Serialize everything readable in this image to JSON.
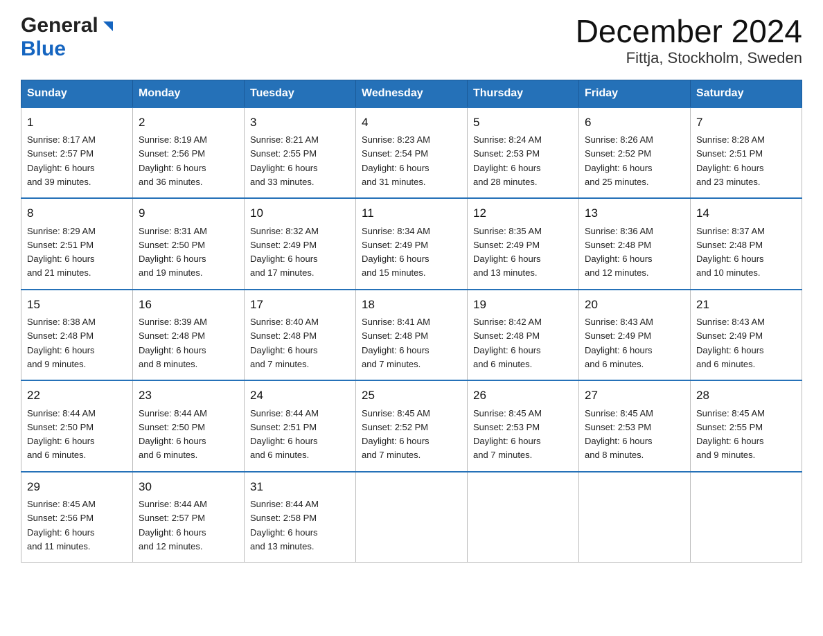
{
  "header": {
    "logo_general": "General",
    "logo_blue": "Blue",
    "month_title": "December 2024",
    "location": "Fittja, Stockholm, Sweden"
  },
  "days_of_week": [
    "Sunday",
    "Monday",
    "Tuesday",
    "Wednesday",
    "Thursday",
    "Friday",
    "Saturday"
  ],
  "weeks": [
    [
      {
        "day": "1",
        "sunrise": "8:17 AM",
        "sunset": "2:57 PM",
        "daylight": "6 hours and 39 minutes."
      },
      {
        "day": "2",
        "sunrise": "8:19 AM",
        "sunset": "2:56 PM",
        "daylight": "6 hours and 36 minutes."
      },
      {
        "day": "3",
        "sunrise": "8:21 AM",
        "sunset": "2:55 PM",
        "daylight": "6 hours and 33 minutes."
      },
      {
        "day": "4",
        "sunrise": "8:23 AM",
        "sunset": "2:54 PM",
        "daylight": "6 hours and 31 minutes."
      },
      {
        "day": "5",
        "sunrise": "8:24 AM",
        "sunset": "2:53 PM",
        "daylight": "6 hours and 28 minutes."
      },
      {
        "day": "6",
        "sunrise": "8:26 AM",
        "sunset": "2:52 PM",
        "daylight": "6 hours and 25 minutes."
      },
      {
        "day": "7",
        "sunrise": "8:28 AM",
        "sunset": "2:51 PM",
        "daylight": "6 hours and 23 minutes."
      }
    ],
    [
      {
        "day": "8",
        "sunrise": "8:29 AM",
        "sunset": "2:51 PM",
        "daylight": "6 hours and 21 minutes."
      },
      {
        "day": "9",
        "sunrise": "8:31 AM",
        "sunset": "2:50 PM",
        "daylight": "6 hours and 19 minutes."
      },
      {
        "day": "10",
        "sunrise": "8:32 AM",
        "sunset": "2:49 PM",
        "daylight": "6 hours and 17 minutes."
      },
      {
        "day": "11",
        "sunrise": "8:34 AM",
        "sunset": "2:49 PM",
        "daylight": "6 hours and 15 minutes."
      },
      {
        "day": "12",
        "sunrise": "8:35 AM",
        "sunset": "2:49 PM",
        "daylight": "6 hours and 13 minutes."
      },
      {
        "day": "13",
        "sunrise": "8:36 AM",
        "sunset": "2:48 PM",
        "daylight": "6 hours and 12 minutes."
      },
      {
        "day": "14",
        "sunrise": "8:37 AM",
        "sunset": "2:48 PM",
        "daylight": "6 hours and 10 minutes."
      }
    ],
    [
      {
        "day": "15",
        "sunrise": "8:38 AM",
        "sunset": "2:48 PM",
        "daylight": "6 hours and 9 minutes."
      },
      {
        "day": "16",
        "sunrise": "8:39 AM",
        "sunset": "2:48 PM",
        "daylight": "6 hours and 8 minutes."
      },
      {
        "day": "17",
        "sunrise": "8:40 AM",
        "sunset": "2:48 PM",
        "daylight": "6 hours and 7 minutes."
      },
      {
        "day": "18",
        "sunrise": "8:41 AM",
        "sunset": "2:48 PM",
        "daylight": "6 hours and 7 minutes."
      },
      {
        "day": "19",
        "sunrise": "8:42 AM",
        "sunset": "2:48 PM",
        "daylight": "6 hours and 6 minutes."
      },
      {
        "day": "20",
        "sunrise": "8:43 AM",
        "sunset": "2:49 PM",
        "daylight": "6 hours and 6 minutes."
      },
      {
        "day": "21",
        "sunrise": "8:43 AM",
        "sunset": "2:49 PM",
        "daylight": "6 hours and 6 minutes."
      }
    ],
    [
      {
        "day": "22",
        "sunrise": "8:44 AM",
        "sunset": "2:50 PM",
        "daylight": "6 hours and 6 minutes."
      },
      {
        "day": "23",
        "sunrise": "8:44 AM",
        "sunset": "2:50 PM",
        "daylight": "6 hours and 6 minutes."
      },
      {
        "day": "24",
        "sunrise": "8:44 AM",
        "sunset": "2:51 PM",
        "daylight": "6 hours and 6 minutes."
      },
      {
        "day": "25",
        "sunrise": "8:45 AM",
        "sunset": "2:52 PM",
        "daylight": "6 hours and 7 minutes."
      },
      {
        "day": "26",
        "sunrise": "8:45 AM",
        "sunset": "2:53 PM",
        "daylight": "6 hours and 7 minutes."
      },
      {
        "day": "27",
        "sunrise": "8:45 AM",
        "sunset": "2:53 PM",
        "daylight": "6 hours and 8 minutes."
      },
      {
        "day": "28",
        "sunrise": "8:45 AM",
        "sunset": "2:55 PM",
        "daylight": "6 hours and 9 minutes."
      }
    ],
    [
      {
        "day": "29",
        "sunrise": "8:45 AM",
        "sunset": "2:56 PM",
        "daylight": "6 hours and 11 minutes."
      },
      {
        "day": "30",
        "sunrise": "8:44 AM",
        "sunset": "2:57 PM",
        "daylight": "6 hours and 12 minutes."
      },
      {
        "day": "31",
        "sunrise": "8:44 AM",
        "sunset": "2:58 PM",
        "daylight": "6 hours and 13 minutes."
      },
      null,
      null,
      null,
      null
    ]
  ],
  "labels": {
    "sunrise": "Sunrise:",
    "sunset": "Sunset:",
    "daylight": "Daylight:"
  }
}
